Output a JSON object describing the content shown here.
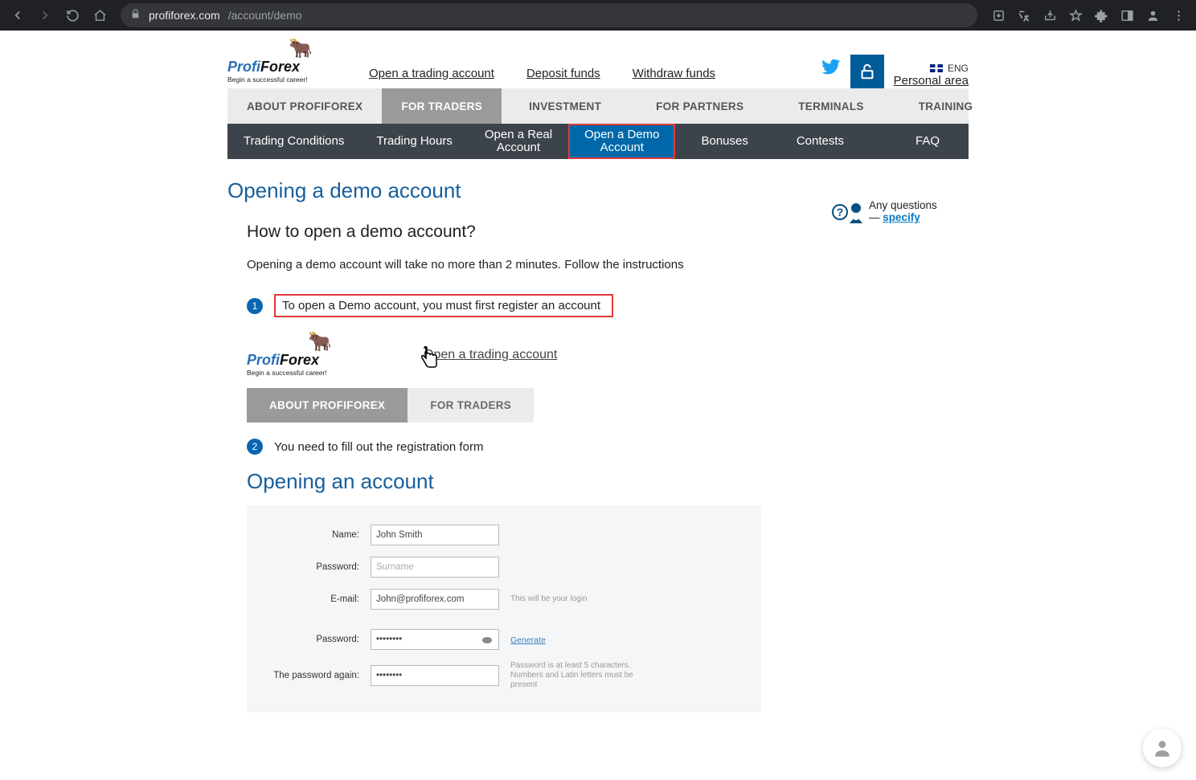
{
  "browser": {
    "url_host": "profiforex.com",
    "url_path": "/account/demo"
  },
  "header": {
    "logo_line1a": "Profi",
    "logo_line1b": "Forex",
    "logo_sub": "Begin a successful career!",
    "links": {
      "open": "Open a trading account",
      "deposit": "Deposit funds",
      "withdraw": "Withdraw funds"
    },
    "lang": "ENG",
    "personal": "Personal area"
  },
  "nav1": {
    "about": "ABOUT PROFIFOREX",
    "traders": "FOR TRADERS",
    "investment": "INVESTMENT",
    "partners": "FOR PARTNERS",
    "terminals": "TERMINALS",
    "training": "TRAINING"
  },
  "nav2": {
    "conditions": "Trading Conditions",
    "hours": "Trading Hours",
    "real1": "Open a Real",
    "real2": "Account",
    "demo1": "Open a Demo",
    "demo2": "Account",
    "bonuses": "Bonuses",
    "contests": "Contests",
    "faq": "FAQ"
  },
  "questions": {
    "l1": "Any questions",
    "dash": "— ",
    "link": "specify"
  },
  "page": {
    "title": "Opening a demo account",
    "subtitle": "How to open a demo account?",
    "lead": "Opening a demo account will take no more than 2 minutes. Follow the instructions",
    "step1_num": "1",
    "step1_text": "To open a Demo account, you must first  register an account",
    "step2_num": "2",
    "step2_text": "You need to fill out the registration form",
    "mini_link": "Open a trading account",
    "mini_tab_a": "ABOUT PROFIFOREX",
    "mini_tab_b": "FOR TRADERS",
    "open_account": "Opening an account"
  },
  "form": {
    "name_label": "Name:",
    "name_value": "John Smith",
    "surname_label": "Password:",
    "surname_ph": "Surname",
    "email_label": "E-mail:",
    "email_value": "John@profiforex.com",
    "email_hint": "This will be your login",
    "pw_label": "Password:",
    "pw_value": "••••••••",
    "pw_gen": "Generate",
    "pw2_label": "The password again:",
    "pw2_value": "••••••••",
    "pw_hint": "Password is at least 5 characters. Numbers and Latin letters must be present"
  }
}
